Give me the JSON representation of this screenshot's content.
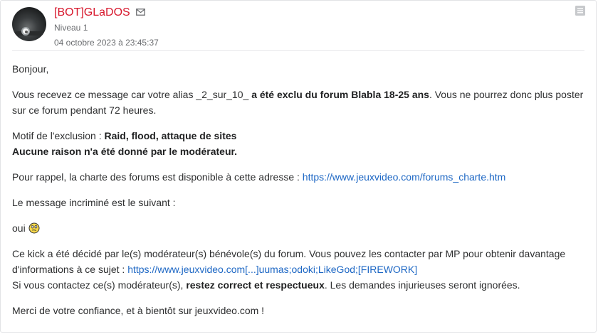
{
  "post": {
    "author": "[BOT]GLaDOS",
    "level": "Niveau 1",
    "date": "04 octobre 2023 à 23:45:37"
  },
  "message": {
    "greeting": "Bonjour,",
    "p1_a": "Vous recevez ce message car votre alias _2_sur_10_ ",
    "p1_bold": "a été exclu du forum Blabla 18-25 ans",
    "p1_b": ". Vous ne pourrez donc plus poster sur ce forum pendant 72 heures.",
    "motif_label": "Motif de l'exclusion : ",
    "motif_value": "Raid, flood, attaque de sites",
    "no_reason": "Aucune raison n'a été donné par le modérateur.",
    "rappel_text": "Pour rappel, la charte des forums est disponible à cette adresse : ",
    "rappel_link": "https://www.jeuxvideo.com/forums_charte.htm",
    "incrimine": "Le message incriminé est le suivant :",
    "quoted": "oui ",
    "kick_a": "Ce kick a été décidé par le(s) modérateur(s) bénévole(s) du forum. Vous pouvez les contacter par MP pour obtenir davantage d'informations à ce sujet : ",
    "kick_link": "https://www.jeuxvideo.com[...]uumas;odoki;LikeGod;[FIREWORK]",
    "contact_a": "Si vous contactez ce(s) modérateur(s), ",
    "contact_bold": "restez correct et respectueux",
    "contact_b": ". Les demandes injurieuses seront ignorées.",
    "closing": "Merci de votre confiance, et à bientôt sur jeuxvideo.com !"
  },
  "colors": {
    "author": "#d7162b",
    "link": "#1d67c4",
    "meta": "#6b6d70"
  },
  "icons": [
    "mail-icon",
    "ticket-icon",
    "smiley-icon"
  ]
}
